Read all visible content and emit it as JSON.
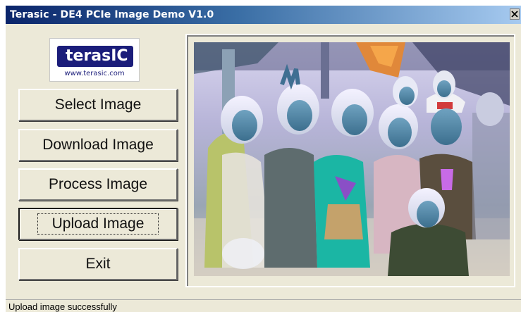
{
  "window": {
    "title": "Terasic - DE4 PCIe Image Demo V1.0",
    "close_glyph": "X"
  },
  "logo": {
    "word": "terasIC",
    "url": "www.terasic.com",
    "brand_color": "#1b1d7a"
  },
  "buttons": [
    {
      "label": "Select Image"
    },
    {
      "label": "Download Image"
    },
    {
      "label": "Process Image"
    },
    {
      "label": "Upload Image",
      "focused": true
    },
    {
      "label": "Exit"
    }
  ],
  "image_panel": {
    "content": "inverted-color group photo"
  },
  "status": {
    "text": "Upload image successfully"
  },
  "colors": {
    "titlebar_start": "#0a246a",
    "titlebar_end": "#a6caf0",
    "dialog_bg": "#ece9d8"
  }
}
